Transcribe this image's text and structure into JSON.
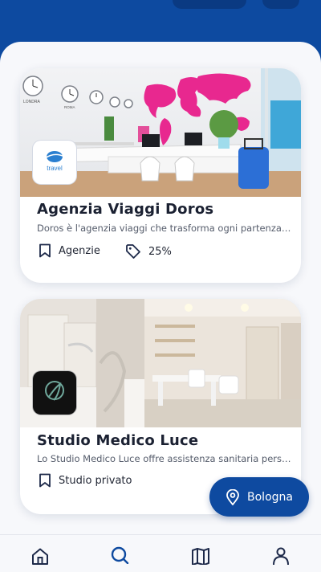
{
  "listings": [
    {
      "title": "Agenzia Viaggi Doros",
      "description": "Doros è l'agenzia viaggi che trasforma ogni partenza in un'esperienza",
      "logo_text": "travel",
      "tags": [
        {
          "icon": "bookmark-icon",
          "label": "Agenzie"
        },
        {
          "icon": "discount-tag-icon",
          "label": "25%"
        }
      ],
      "clocks": [
        "LONDRA",
        "ROMA",
        "",
        "",
        ""
      ]
    },
    {
      "title": "Studio Medico Luce",
      "description": "Lo Studio Medico Luce offre assistenza sanitaria personalizzata",
      "tags": [
        {
          "icon": "bookmark-icon",
          "label": "Studio privato"
        }
      ]
    }
  ],
  "location_button": {
    "label": "Bologna",
    "icon": "map-pin-icon"
  },
  "bottom_nav": [
    {
      "icon": "home-icon"
    },
    {
      "icon": "search-icon",
      "active": true
    },
    {
      "icon": "map-icon"
    },
    {
      "icon": "profile-icon"
    }
  ],
  "colors": {
    "primary": "#0e4aa0",
    "header_bg": "#0d4aa0",
    "world_map": "#e8288f"
  }
}
